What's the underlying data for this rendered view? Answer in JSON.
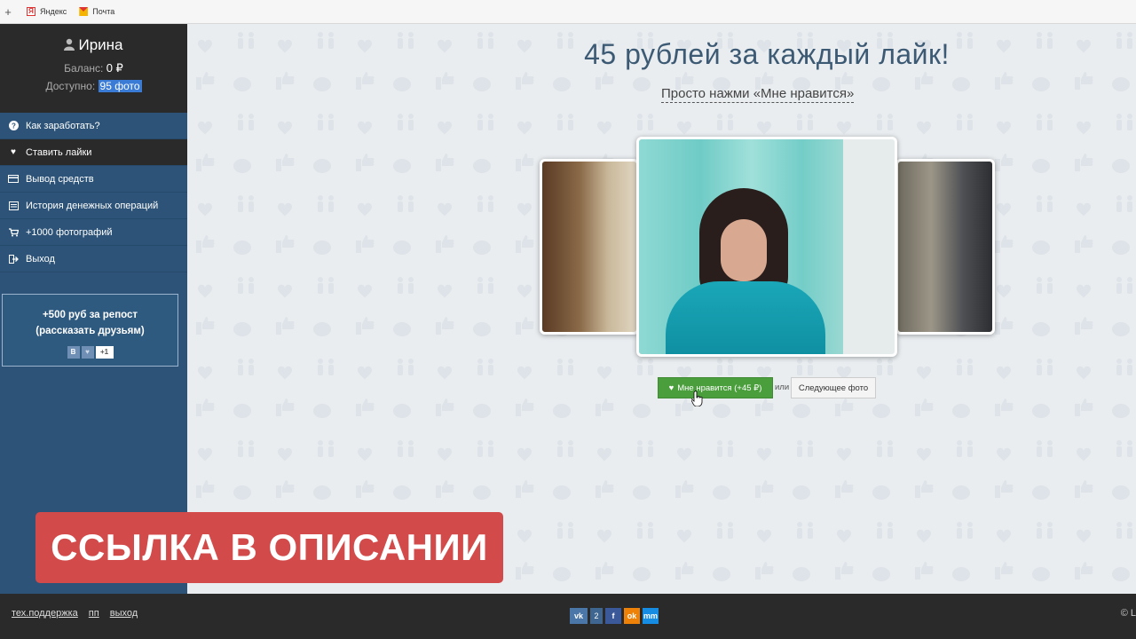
{
  "browser": {
    "bookmarks": [
      {
        "label": "Яндекс",
        "icon": "yandex-icon"
      },
      {
        "label": "Почта",
        "icon": "mail-icon"
      }
    ]
  },
  "sidebar": {
    "user_name": "Ирина",
    "balance_label": "Баланс:",
    "balance_value": "0 ₽",
    "available_label": "Доступно:",
    "available_value": "95 фото",
    "menu": [
      {
        "label": "Как заработать?",
        "icon": "question-icon"
      },
      {
        "label": "Ставить лайки",
        "icon": "heart-icon",
        "active": true
      },
      {
        "label": "Вывод средств",
        "icon": "card-icon"
      },
      {
        "label": "История денежных операций",
        "icon": "list-icon"
      },
      {
        "label": "+1000 фотографий",
        "icon": "cart-icon"
      },
      {
        "label": "Выход",
        "icon": "exit-icon"
      }
    ],
    "repost": {
      "line1": "+500 руб за репост",
      "line2": "(рассказать друзьям)",
      "vk_label": "В",
      "count": "+1"
    }
  },
  "main": {
    "headline": "45 рублей за каждый лайк!",
    "subline": "Просто нажми «Мне нравится»",
    "like_button": "Мне нравится (+45 ₽)",
    "or_text": "или",
    "next_button": "Следующее фото"
  },
  "banner": {
    "text": "ССЫЛКА В ОПИСАНИИ"
  },
  "footer": {
    "links": [
      "тех.поддержка",
      "пп",
      "выход"
    ],
    "social": {
      "vk": "vk",
      "vk_count": "2",
      "fb": "f",
      "ok": "ok",
      "mm": "mm"
    },
    "copyright": "© L"
  },
  "colors": {
    "sidebar": "#2d5478",
    "user_box": "#2a2a2a",
    "like_button": "#4a9e3c",
    "banner": "#d24a4a",
    "main_bg": "#e9edf0"
  }
}
